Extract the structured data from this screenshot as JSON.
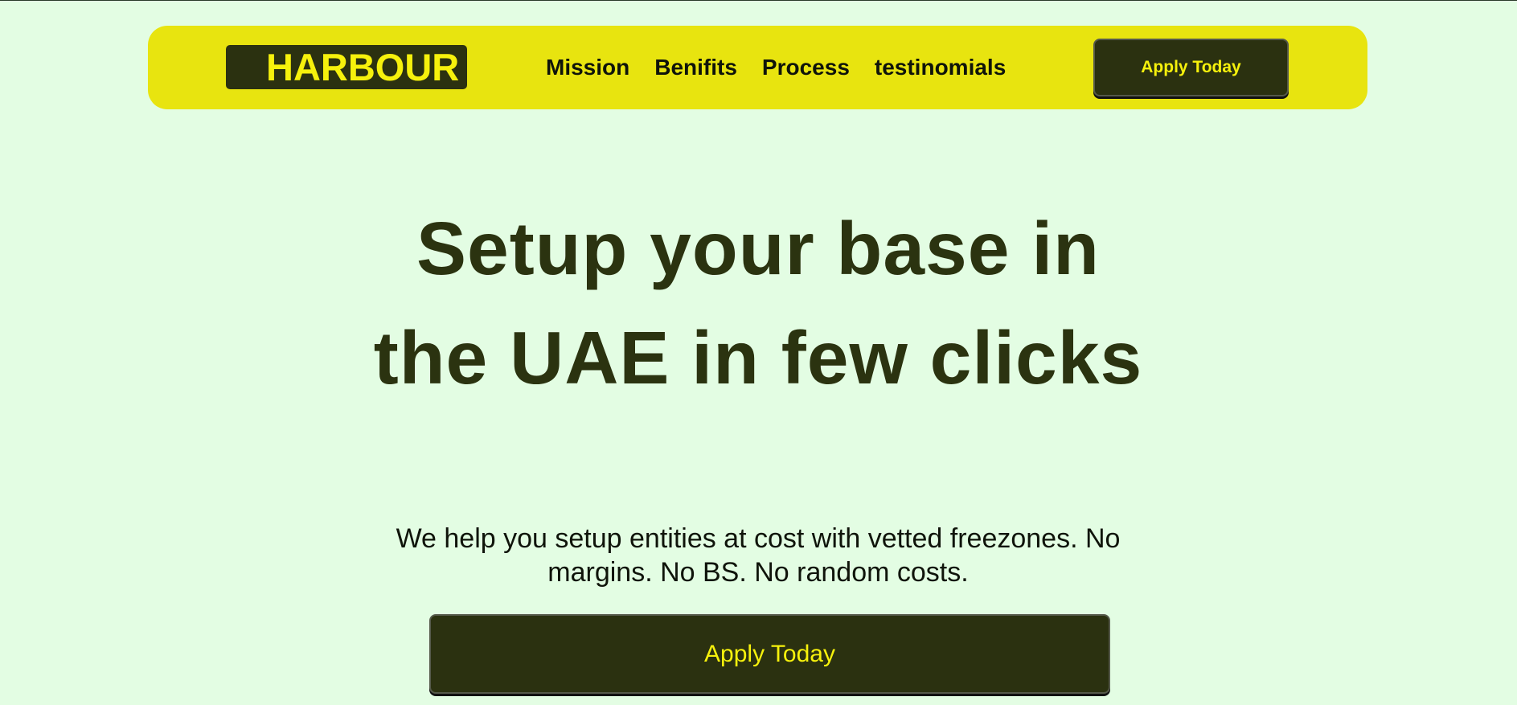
{
  "brand": {
    "logo_text": "HARBOUR"
  },
  "nav": {
    "links": [
      {
        "label": "Mission"
      },
      {
        "label": "Benifits"
      },
      {
        "label": "Process"
      },
      {
        "label": "testinomials"
      }
    ],
    "cta_label": "Apply Today"
  },
  "hero": {
    "title": "Setup your base in the UAE in few clicks",
    "subtitle": "We help you setup entities at cost with vetted freezones. No margins. No BS. No random costs.",
    "cta_label": "Apply Today"
  },
  "colors": {
    "background": "#e3fde3",
    "navbar": "#e8e40f",
    "dark_accent": "#2b3110",
    "cta_text": "#f6f10c"
  }
}
